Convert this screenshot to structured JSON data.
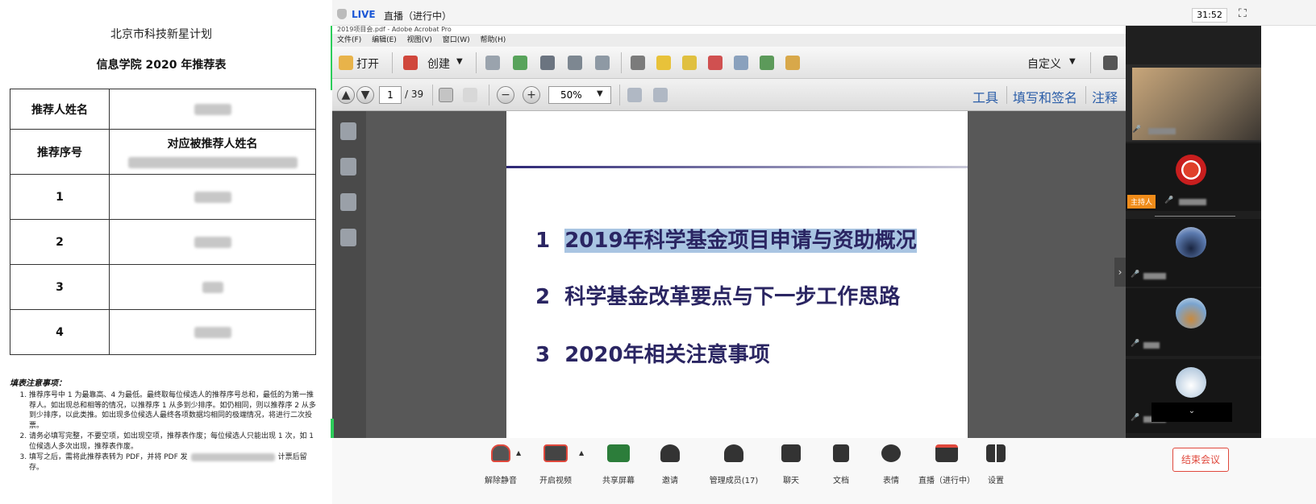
{
  "document": {
    "title": "北京市科技新星计划",
    "subtitle": "信息学院 2020 年推荐表",
    "table": {
      "recommender_label": "推荐人姓名",
      "order_label": "推荐序号",
      "candidate_label": "对应被推荐人姓名",
      "rows": [
        "1",
        "2",
        "3",
        "4"
      ]
    },
    "notes_title": "填表注意事项：",
    "notes": [
      "推荐序号中 1 为最靠高、4 为最低。最终取每位候选人的推荐序号总和，最低的为第一推荐人。如出现总和相等的情况，以推荐序 1 从多到少排序。如仍相同，则以推荐序 2 从多到少排序，以此类推。如出现多位候选人最终各项数据均相同的极端情况，将进行二次投票。",
      "请务必填写完整，不要空项，如出现空项，推荐表作废；每位候选人只能出现 1 次，如 1 位候选人多次出现，推荐表作废。",
      "填写之后，需将此推荐表转为 PDF，并将 PDF 发",
      "计票后留存。"
    ]
  },
  "meeting": {
    "live_label": "LIVE",
    "record_status": "直播（进行中）",
    "timer": "31:52",
    "acrobat": {
      "title": "2019项目会.pdf - Adobe Acrobat Pro",
      "menu": [
        "文件(F)",
        "编辑(E)",
        "视图(V)",
        "窗口(W)",
        "帮助(H)"
      ],
      "open_label": "打开",
      "create_label": "创建",
      "customize_label": "自定义",
      "page_current": "1",
      "page_total": "/ 39",
      "zoom": "50%",
      "panels": [
        "工具",
        "填写和签名",
        "注释"
      ]
    },
    "slide": {
      "items": [
        {
          "num": "1",
          "text": "2019年科学基金项目申请与资助概况"
        },
        {
          "num": "2",
          "text": "科学基金改革要点与下一步工作思路"
        },
        {
          "num": "3",
          "text": "2020年相关注意事项"
        }
      ]
    },
    "participants": {
      "host_badge": "主持人"
    },
    "bottom_bar": {
      "buttons": [
        "解除静音",
        "开启视频",
        "共享屏幕",
        "邀请",
        "管理成员(17)",
        "聊天",
        "文档",
        "表情",
        "直播（进行中）",
        "设置"
      ],
      "end_label": "结束会议"
    }
  }
}
